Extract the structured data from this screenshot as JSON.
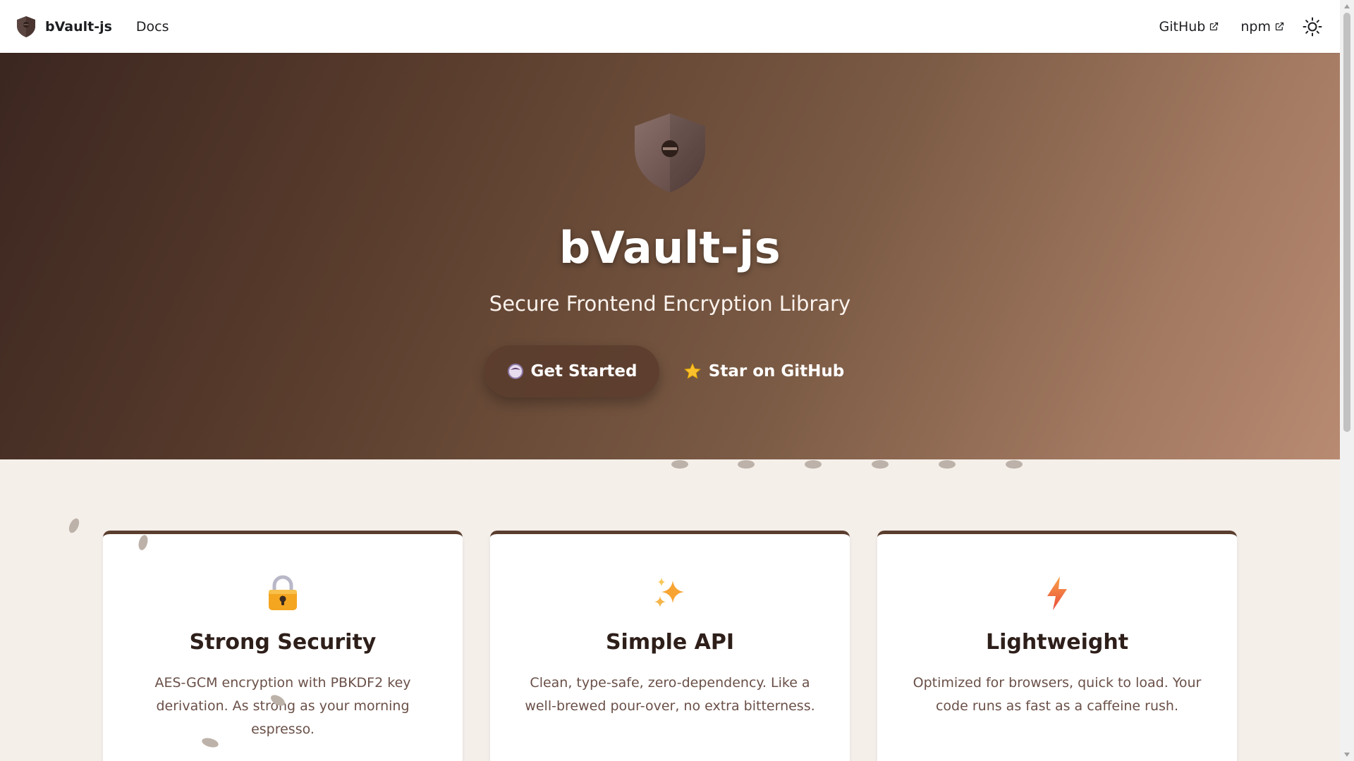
{
  "navbar": {
    "brand": "bVault-js",
    "docs": "Docs",
    "github": "GitHub",
    "npm": "npm"
  },
  "hero": {
    "title": "bVault-js",
    "tagline": "Secure Frontend Encryption Library",
    "primary_button": "Get Started",
    "secondary_button": "Star on GitHub"
  },
  "features": [
    {
      "title": "Strong Security",
      "description": "AES-GCM encryption with PBKDF2 key derivation. As strong as your morning espresso.",
      "icon": "lock-icon"
    },
    {
      "title": "Simple API",
      "description": "Clean, type-safe, zero-dependency. Like a well-brewed pour-over, no extra bitterness.",
      "icon": "sparkles-icon"
    },
    {
      "title": "Lightweight",
      "description": "Optimized for browsers, quick to load. Your code runs as fast as a caffeine rush.",
      "icon": "lightning-icon"
    }
  ],
  "colors": {
    "hero_start": "#3b2620",
    "hero_end": "#b88a72",
    "card_accent": "#5a3d2d",
    "page_background": "#f5efea"
  }
}
